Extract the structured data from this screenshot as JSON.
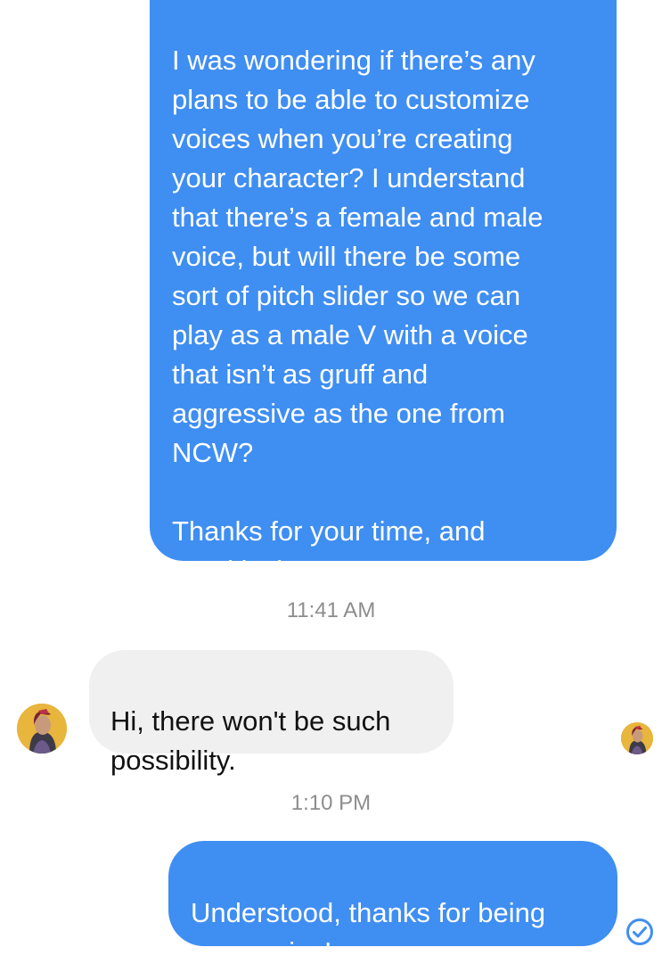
{
  "messages": [
    {
      "id": "msg1",
      "direction": "outgoing",
      "text": "I was wondering if there’s any\nplans to be able to customize\nvoices when you’re creating\nyour character? I understand\nthat there’s a female and male\nvoice, but will there be some\nsort of pitch slider so we can\nplay as a male V with a voice\nthat isn’t as gruff and\naggressive as the one from\nNCW?\n\nThanks for your time, and\ngood luck!"
    },
    {
      "id": "msg2",
      "direction": "incoming",
      "text": "Hi, there won't be such\npossibility."
    },
    {
      "id": "msg3",
      "direction": "outgoing",
      "text": "Understood, thanks for being\nresponsive!"
    }
  ],
  "timestamps": [
    "11:41 AM",
    "1:10 PM"
  ],
  "icons": {
    "avatar_left": "contact-avatar-icon",
    "avatar_right": "read-receipt-avatar-icon",
    "receipt": "delivered-check-icon"
  },
  "colors": {
    "outgoing_bubble": "#3f8ef2",
    "incoming_bubble": "#f0f0f0",
    "timestamp": "#8d8d8d",
    "receipt": "#3f8ef2"
  }
}
